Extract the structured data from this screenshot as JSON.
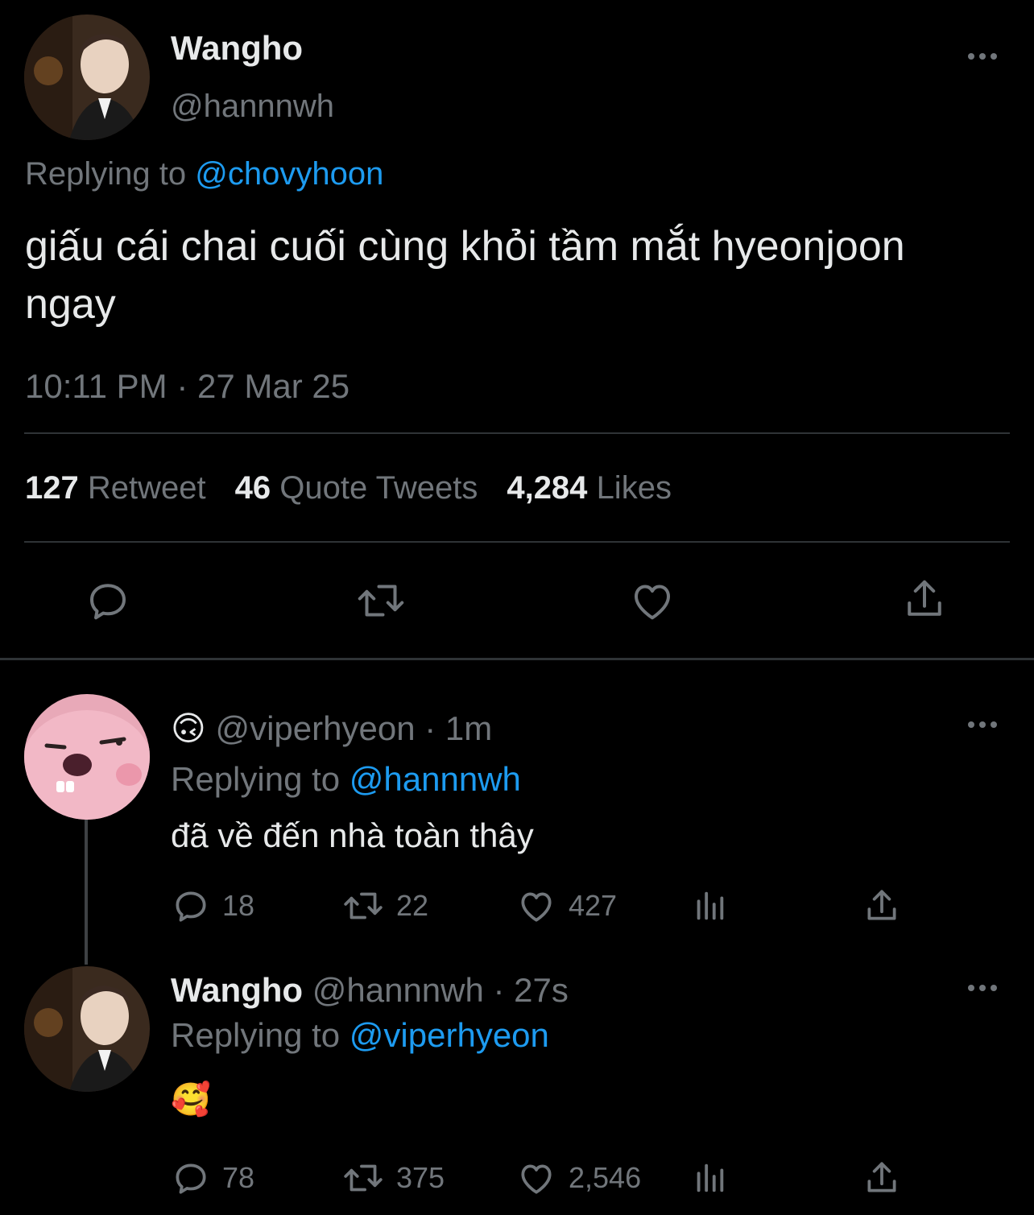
{
  "main_tweet": {
    "display_name": "Wangho",
    "handle": "@hannnwh",
    "replying_prefix": "Replying to",
    "replying_to": "@chovyhoon",
    "text": "giấu cái chai cuối cùng khỏi tầm mắt hyeonjoon ngay",
    "timestamp": "10:11 PM · 27 Mar 25",
    "stats": {
      "retweets_count": "127",
      "retweets_label": "Retweet",
      "quotes_count": "46",
      "quotes_label": "Quote Tweets",
      "likes_count": "4,284",
      "likes_label": "Likes"
    }
  },
  "replies": [
    {
      "name_emoji": "🙃",
      "handle": "@viperhyeon",
      "time": "· 1m",
      "replying_prefix": "Replying to",
      "replying_to": "@hannnwh",
      "text": "đã về đến nhà toàn thây",
      "replies": "18",
      "retweets": "22",
      "likes": "427"
    },
    {
      "display_name": "Wangho",
      "handle": "@hannnwh",
      "time": "· 27s",
      "replying_prefix": "Replying to",
      "replying_to": "@viperhyeon",
      "text": "🥰",
      "replies": "78",
      "retweets": "375",
      "likes": "2,546"
    }
  ],
  "colors": {
    "background": "#000000",
    "text": "#e7e9ea",
    "muted": "#71767b",
    "link": "#1d9bf0",
    "divider": "#2f3336"
  }
}
